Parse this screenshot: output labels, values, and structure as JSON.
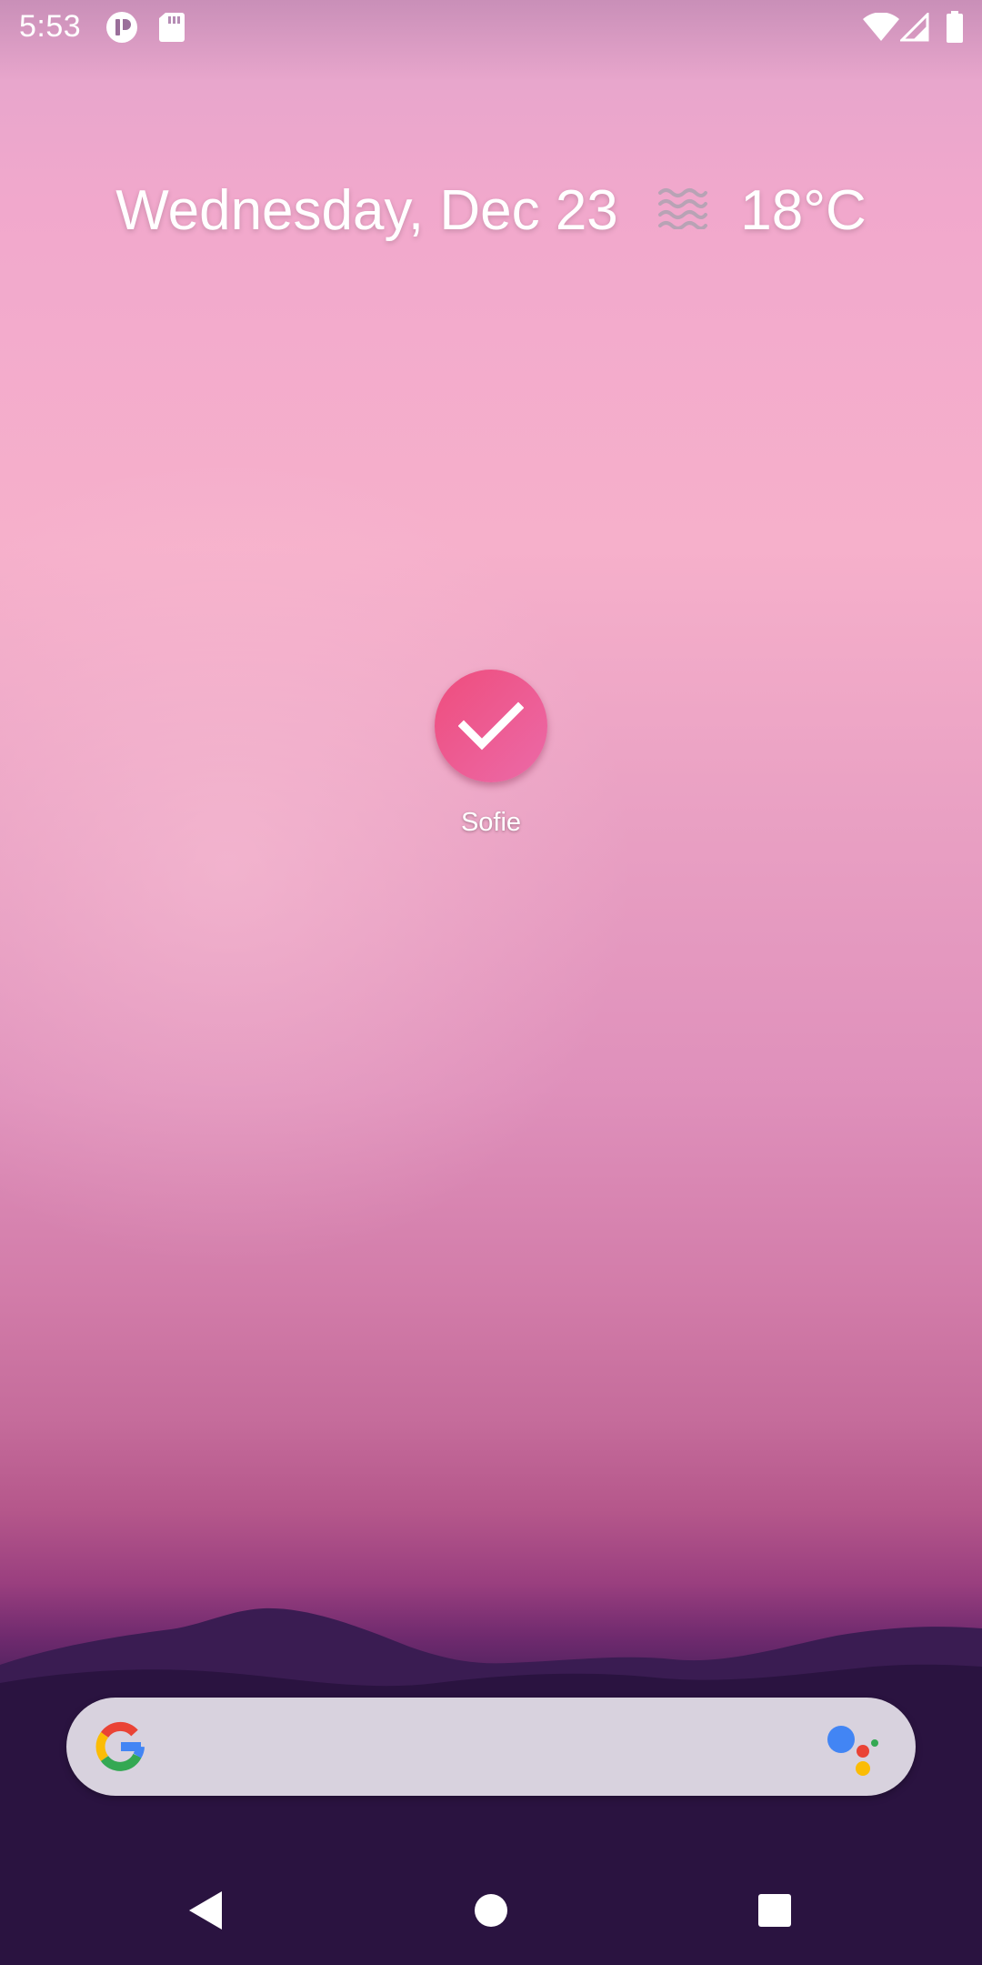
{
  "status_bar": {
    "time": "5:53",
    "left_icons": [
      "app-notification-icon",
      "sd-card-icon"
    ],
    "right_icons": [
      "wifi-icon",
      "cell-signal-icon",
      "battery-icon"
    ]
  },
  "glance": {
    "date": "Wednesday, Dec 23",
    "weather_icon": "haze-icon",
    "temperature": "18°C"
  },
  "home_apps": [
    {
      "label": "Sofie",
      "icon": "check-icon",
      "color": "#ee5a8e"
    }
  ],
  "search_bar": {
    "value": "",
    "placeholder": "",
    "logo": "google-g-logo",
    "assistant": "google-assistant-icon"
  },
  "nav_bar": {
    "buttons": [
      "back-button",
      "home-button",
      "recents-button"
    ]
  },
  "colors": {
    "app_icon": "#ee5a8e",
    "search_bar": "#d8d2de",
    "nav_background": "#200d33"
  }
}
